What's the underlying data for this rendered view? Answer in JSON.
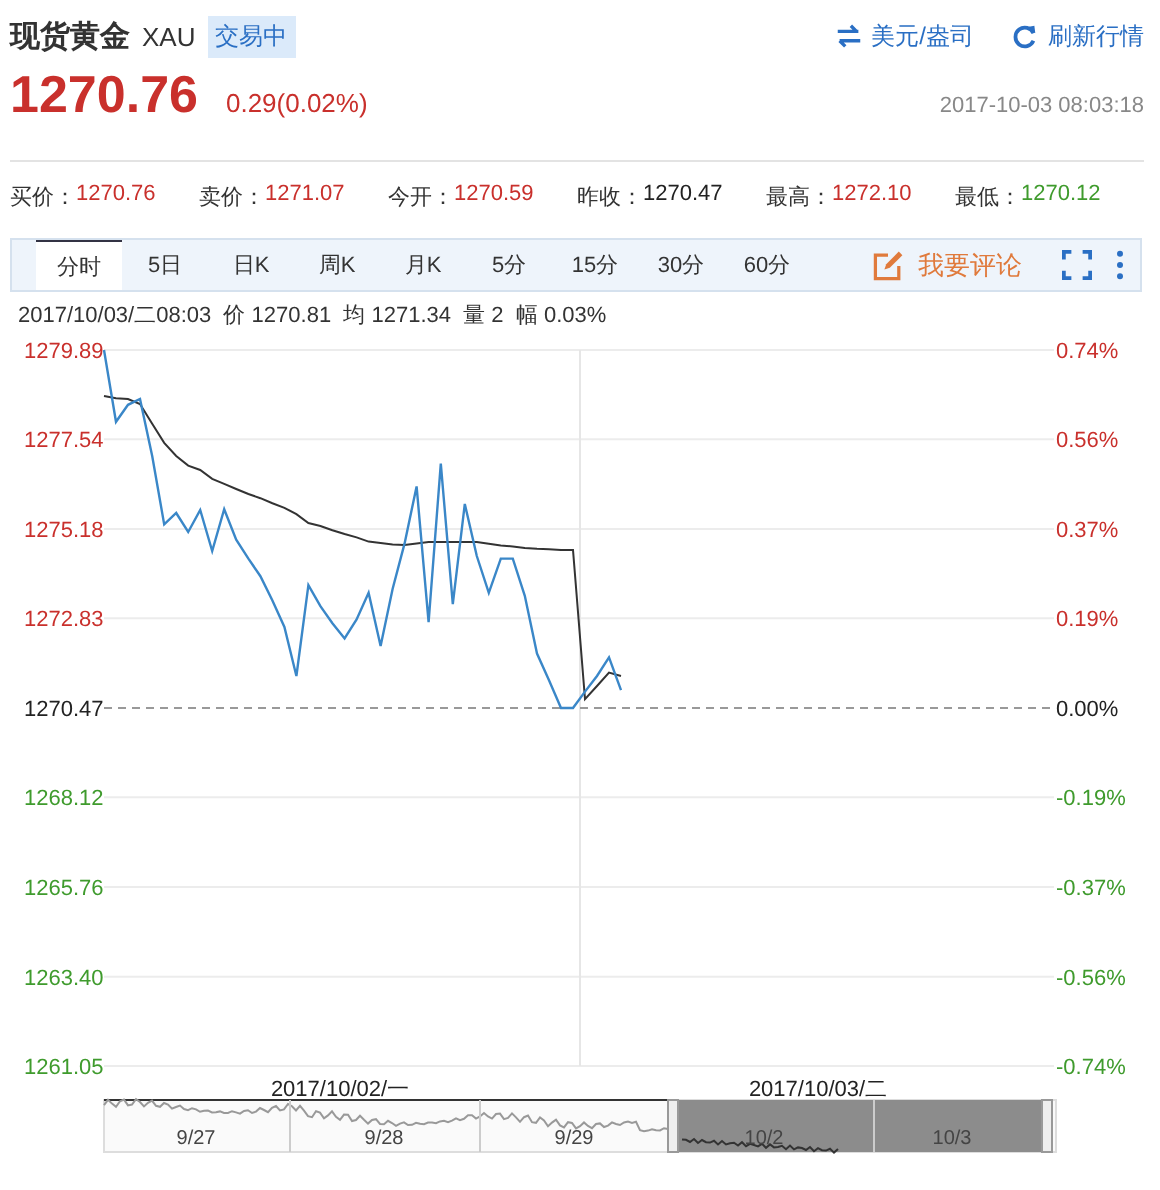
{
  "header": {
    "title": "现货黄金",
    "code": "XAU",
    "status": "交易中",
    "links": [
      {
        "kind": "swap",
        "label": "美元/盎司"
      },
      {
        "kind": "refresh",
        "label": "刷新行情"
      }
    ]
  },
  "quote": {
    "price": "1270.76",
    "change": "0.29(0.02%)",
    "color": "#c9302c",
    "time": "2017-10-03 08:03:18"
  },
  "stats": [
    {
      "label": "买价：",
      "value": "1270.76",
      "color": "#c9302c"
    },
    {
      "label": "卖价：",
      "value": "1271.07",
      "color": "#c9302c"
    },
    {
      "label": "今开：",
      "value": "1270.59",
      "color": "#c9302c"
    },
    {
      "label": "昨收：",
      "value": "1270.47",
      "color": "#222222"
    },
    {
      "label": "最高：",
      "value": "1272.10",
      "color": "#c9302c"
    },
    {
      "label": "最低：",
      "value": "1270.12",
      "color": "#3f9b2d"
    }
  ],
  "toolbar": {
    "tabs": [
      {
        "label": "分时",
        "selected": true
      },
      {
        "label": "5日",
        "selected": false
      },
      {
        "label": "日K",
        "selected": false
      },
      {
        "label": "周K",
        "selected": false
      },
      {
        "label": "月K",
        "selected": false
      },
      {
        "label": "5分",
        "selected": false
      },
      {
        "label": "15分",
        "selected": false
      },
      {
        "label": "30分",
        "selected": false
      },
      {
        "label": "60分",
        "selected": false
      }
    ],
    "comment_button": "我要评论"
  },
  "info": "2017/10/03/二08:03  价 1270.81  均 1271.34  量 2  幅 0.03%",
  "chart": {
    "percent_labels": [
      {
        "text": "0.74%",
        "color": "#c9302c"
      },
      {
        "text": "0.56%",
        "color": "#c9302c"
      },
      {
        "text": "0.37%",
        "color": "#c9302c"
      },
      {
        "text": "0.19%",
        "color": "#c9302c"
      },
      {
        "text": "0.00%",
        "color": "#222222"
      },
      {
        "text": "-0.19%",
        "color": "#3f9b2d"
      },
      {
        "text": "-0.37%",
        "color": "#3f9b2d"
      },
      {
        "text": "-0.56%",
        "color": "#3f9b2d"
      },
      {
        "text": "-0.74%",
        "color": "#3f9b2d"
      }
    ],
    "chart_data": {
      "type": "line",
      "categories": [
        null,
        null,
        null,
        null,
        null,
        null,
        null,
        null,
        null,
        null,
        null,
        null,
        null,
        null,
        null,
        null,
        null,
        null,
        null,
        null,
        null,
        null,
        null,
        null,
        null,
        null,
        null,
        null,
        null,
        null,
        null,
        null,
        null,
        null,
        null,
        null,
        null,
        null,
        null,
        null,
        null,
        null,
        null,
        null,
        null,
        null,
        null,
        null,
        null,
        null,
        null,
        null,
        null,
        null,
        null,
        null,
        null,
        null,
        null,
        null,
        null,
        null,
        null,
        null,
        null,
        null,
        null,
        null,
        null,
        null,
        null,
        null,
        null,
        null,
        null,
        null,
        null,
        null,
        null,
        null
      ],
      "ylim": [
        1261.05,
        1279.89
      ],
      "grid": true,
      "ref_lines": [
        {
          "axis": "y",
          "value": 1270.47
        }
      ],
      "yticks": [
        {
          "value": 1279.89,
          "label": "1279.89"
        },
        {
          "value": 1277.54,
          "label": "1277.54"
        },
        {
          "value": 1275.18,
          "label": "1275.18"
        },
        {
          "value": 1272.83,
          "label": "1272.83"
        },
        {
          "value": 1270.47,
          "label": "1270.47"
        },
        {
          "value": 1268.12,
          "label": "1268.12"
        },
        {
          "value": 1265.76,
          "label": "1265.76"
        },
        {
          "value": 1263.4,
          "label": "1263.40"
        },
        {
          "value": 1261.05,
          "label": "1261.05"
        }
      ],
      "series": [
        {
          "color": "#3a87c8",
          "values": [
            1279.89,
            1278.0,
            1278.45,
            1278.6,
            1277.1,
            1275.3,
            1275.6,
            1275.1,
            1275.68,
            1274.6,
            1275.7,
            1274.9,
            1274.4,
            1273.94,
            1273.3,
            1272.6,
            1271.31,
            1273.7,
            1273.15,
            1272.7,
            1272.3,
            1272.8,
            1273.5,
            1272.1,
            1273.6,
            1274.8,
            1276.3,
            1272.73,
            1276.9,
            1273.2,
            1275.84,
            1274.47,
            1273.5,
            1274.4,
            1274.4,
            1273.42,
            1271.9,
            1271.2,
            1270.47,
            1270.47,
            1270.9,
            1271.31,
            1271.8,
            1270.94,
            null,
            null,
            null,
            null,
            null,
            null,
            null,
            null,
            null,
            null,
            null,
            null,
            null,
            null,
            null,
            null,
            null,
            null,
            null,
            null,
            null,
            null,
            null,
            null,
            null,
            null,
            null,
            null,
            null,
            null,
            null,
            null,
            null,
            null,
            null,
            null
          ]
        },
        {
          "color": "#333333",
          "values": [
            1278.68,
            1278.62,
            1278.6,
            1278.47,
            1277.95,
            1277.45,
            1277.1,
            1276.85,
            1276.73,
            1276.5,
            1276.37,
            1276.23,
            1276.1,
            1275.99,
            1275.86,
            1275.74,
            1275.57,
            1275.34,
            1275.26,
            1275.15,
            1275.05,
            1274.96,
            1274.85,
            1274.81,
            1274.77,
            1274.76,
            1274.8,
            1274.84,
            1274.84,
            1274.84,
            1274.84,
            1274.84,
            1274.79,
            1274.75,
            1274.72,
            1274.68,
            1274.66,
            1274.65,
            1274.63,
            1274.63,
            1270.7,
            1271.05,
            1271.4,
            1271.31,
            null,
            null,
            null,
            null,
            null,
            null,
            null,
            null,
            null,
            null,
            null,
            null,
            null,
            null,
            null,
            null,
            null,
            null,
            null,
            null,
            null,
            null,
            null,
            null,
            null,
            null,
            null,
            null,
            null,
            null,
            null,
            null,
            null,
            null,
            null,
            null
          ]
        }
      ]
    },
    "navigator": {
      "dates": [
        "2017/10/02/一",
        "2017/10/03/二"
      ],
      "days": [
        "9/27",
        "9/28",
        "9/29",
        "10/2",
        "10/3"
      ]
    }
  }
}
